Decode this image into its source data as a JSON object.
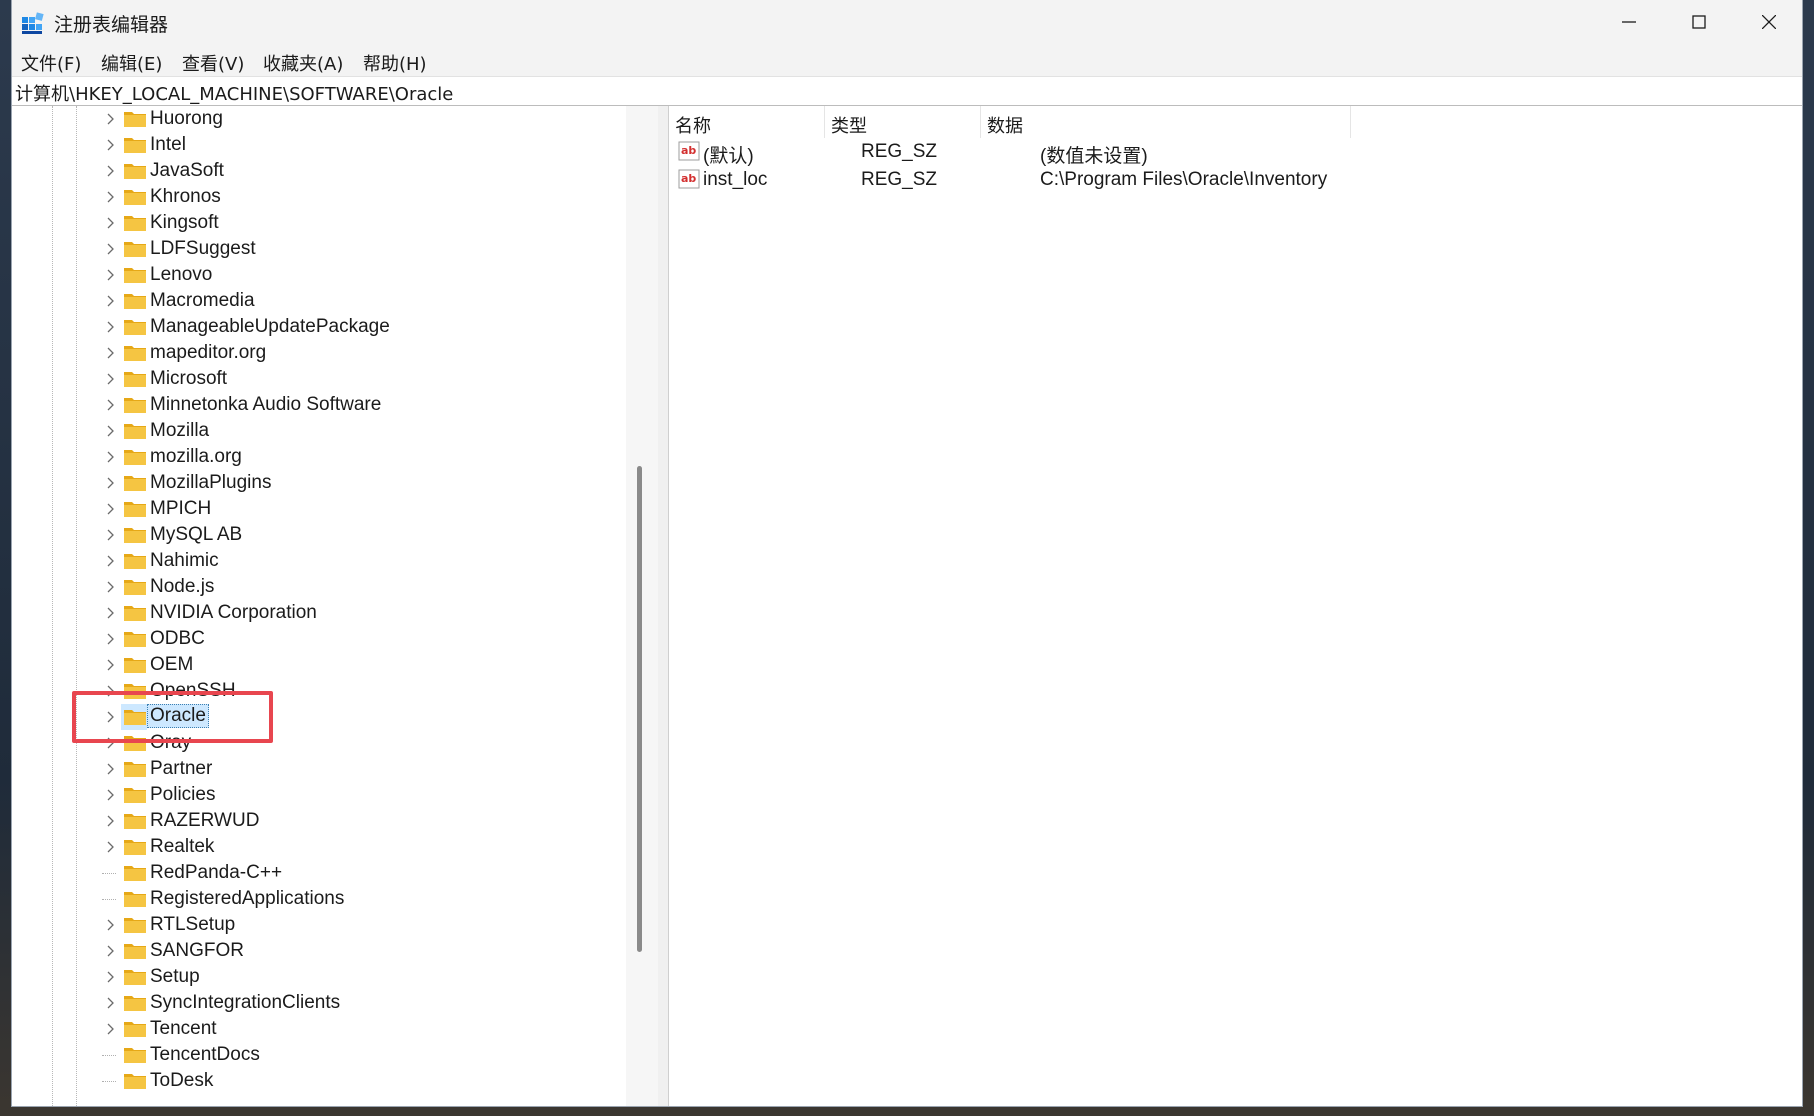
{
  "window": {
    "title": "注册表编辑器",
    "controls": {
      "minimize": "minimize",
      "maximize": "maximize",
      "close": "close"
    }
  },
  "menu": [
    "文件(F)",
    "编辑(E)",
    "查看(V)",
    "收藏夹(A)",
    "帮助(H)"
  ],
  "address": "计算机\\HKEY_LOCAL_MACHINE\\SOFTWARE\\Oracle",
  "tree": {
    "selected": "Oracle",
    "items": [
      {
        "label": "Huorong",
        "expandable": true
      },
      {
        "label": "Intel",
        "expandable": true
      },
      {
        "label": "JavaSoft",
        "expandable": true
      },
      {
        "label": "Khronos",
        "expandable": true
      },
      {
        "label": "Kingsoft",
        "expandable": true
      },
      {
        "label": "LDFSuggest",
        "expandable": true
      },
      {
        "label": "Lenovo",
        "expandable": true
      },
      {
        "label": "Macromedia",
        "expandable": true
      },
      {
        "label": "ManageableUpdatePackage",
        "expandable": true
      },
      {
        "label": "mapeditor.org",
        "expandable": true
      },
      {
        "label": "Microsoft",
        "expandable": true
      },
      {
        "label": "Minnetonka Audio Software",
        "expandable": true
      },
      {
        "label": "Mozilla",
        "expandable": true
      },
      {
        "label": "mozilla.org",
        "expandable": true
      },
      {
        "label": "MozillaPlugins",
        "expandable": true
      },
      {
        "label": "MPICH",
        "expandable": true
      },
      {
        "label": "MySQL AB",
        "expandable": true
      },
      {
        "label": "Nahimic",
        "expandable": true
      },
      {
        "label": "Node.js",
        "expandable": true
      },
      {
        "label": "NVIDIA Corporation",
        "expandable": true
      },
      {
        "label": "ODBC",
        "expandable": true
      },
      {
        "label": "OEM",
        "expandable": true
      },
      {
        "label": "OpenSSH",
        "expandable": true
      },
      {
        "label": "Oracle",
        "expandable": true
      },
      {
        "label": "Oray",
        "expandable": true
      },
      {
        "label": "Partner",
        "expandable": true
      },
      {
        "label": "Policies",
        "expandable": true
      },
      {
        "label": "RAZERWUD",
        "expandable": true
      },
      {
        "label": "Realtek",
        "expandable": true
      },
      {
        "label": "RedPanda-C++",
        "expandable": false
      },
      {
        "label": "RegisteredApplications",
        "expandable": false
      },
      {
        "label": "RTLSetup",
        "expandable": true
      },
      {
        "label": "SANGFOR",
        "expandable": true
      },
      {
        "label": "Setup",
        "expandable": true
      },
      {
        "label": "SyncIntegrationClients",
        "expandable": true
      },
      {
        "label": "Tencent",
        "expandable": true
      },
      {
        "label": "TencentDocs",
        "expandable": false
      },
      {
        "label": "ToDesk",
        "expandable": false
      }
    ]
  },
  "list": {
    "columns": [
      "名称",
      "类型",
      "数据"
    ],
    "rows": [
      {
        "name": "(默认)",
        "type": "REG_SZ",
        "data": "(数值未设置)",
        "icon": "string-value-icon"
      },
      {
        "name": "inst_loc",
        "type": "REG_SZ",
        "data": "C:\\Program Files\\Oracle\\Inventory",
        "icon": "string-value-icon"
      }
    ]
  },
  "colors": {
    "highlight_box": "#e8464f",
    "selection": "#cde8ff",
    "folder": "#f5c542"
  }
}
